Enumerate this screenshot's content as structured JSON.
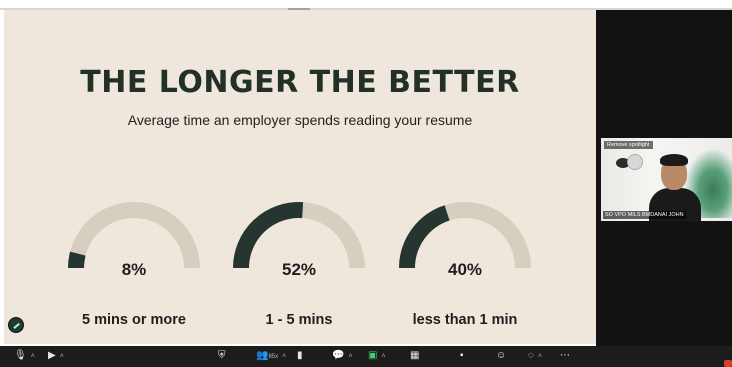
{
  "slide": {
    "title": "THE LONGER THE BETTER",
    "subtitle": "Average time an employer spends reading your resume",
    "gauges": [
      {
        "percent": 8,
        "value_text": "8%",
        "label": "5 mins or more"
      },
      {
        "percent": 52,
        "value_text": "52%",
        "label": "1 - 5 mins"
      },
      {
        "percent": 40,
        "value_text": "40%",
        "label": "less than 1 min"
      }
    ]
  },
  "video": {
    "spotlight_label": "Remove spotlight",
    "name_label": "SO VPO MILS BMDANAI JOHN"
  },
  "toolbar": {
    "participants_count": "85x"
  },
  "colors": {
    "slide_bg": "#efe7dc",
    "gauge_track": "#d6cfbf",
    "gauge_fill": "#273530",
    "title": "#223028",
    "toolbar_bg": "#1c1c1c",
    "dark_panel": "#121212"
  }
}
